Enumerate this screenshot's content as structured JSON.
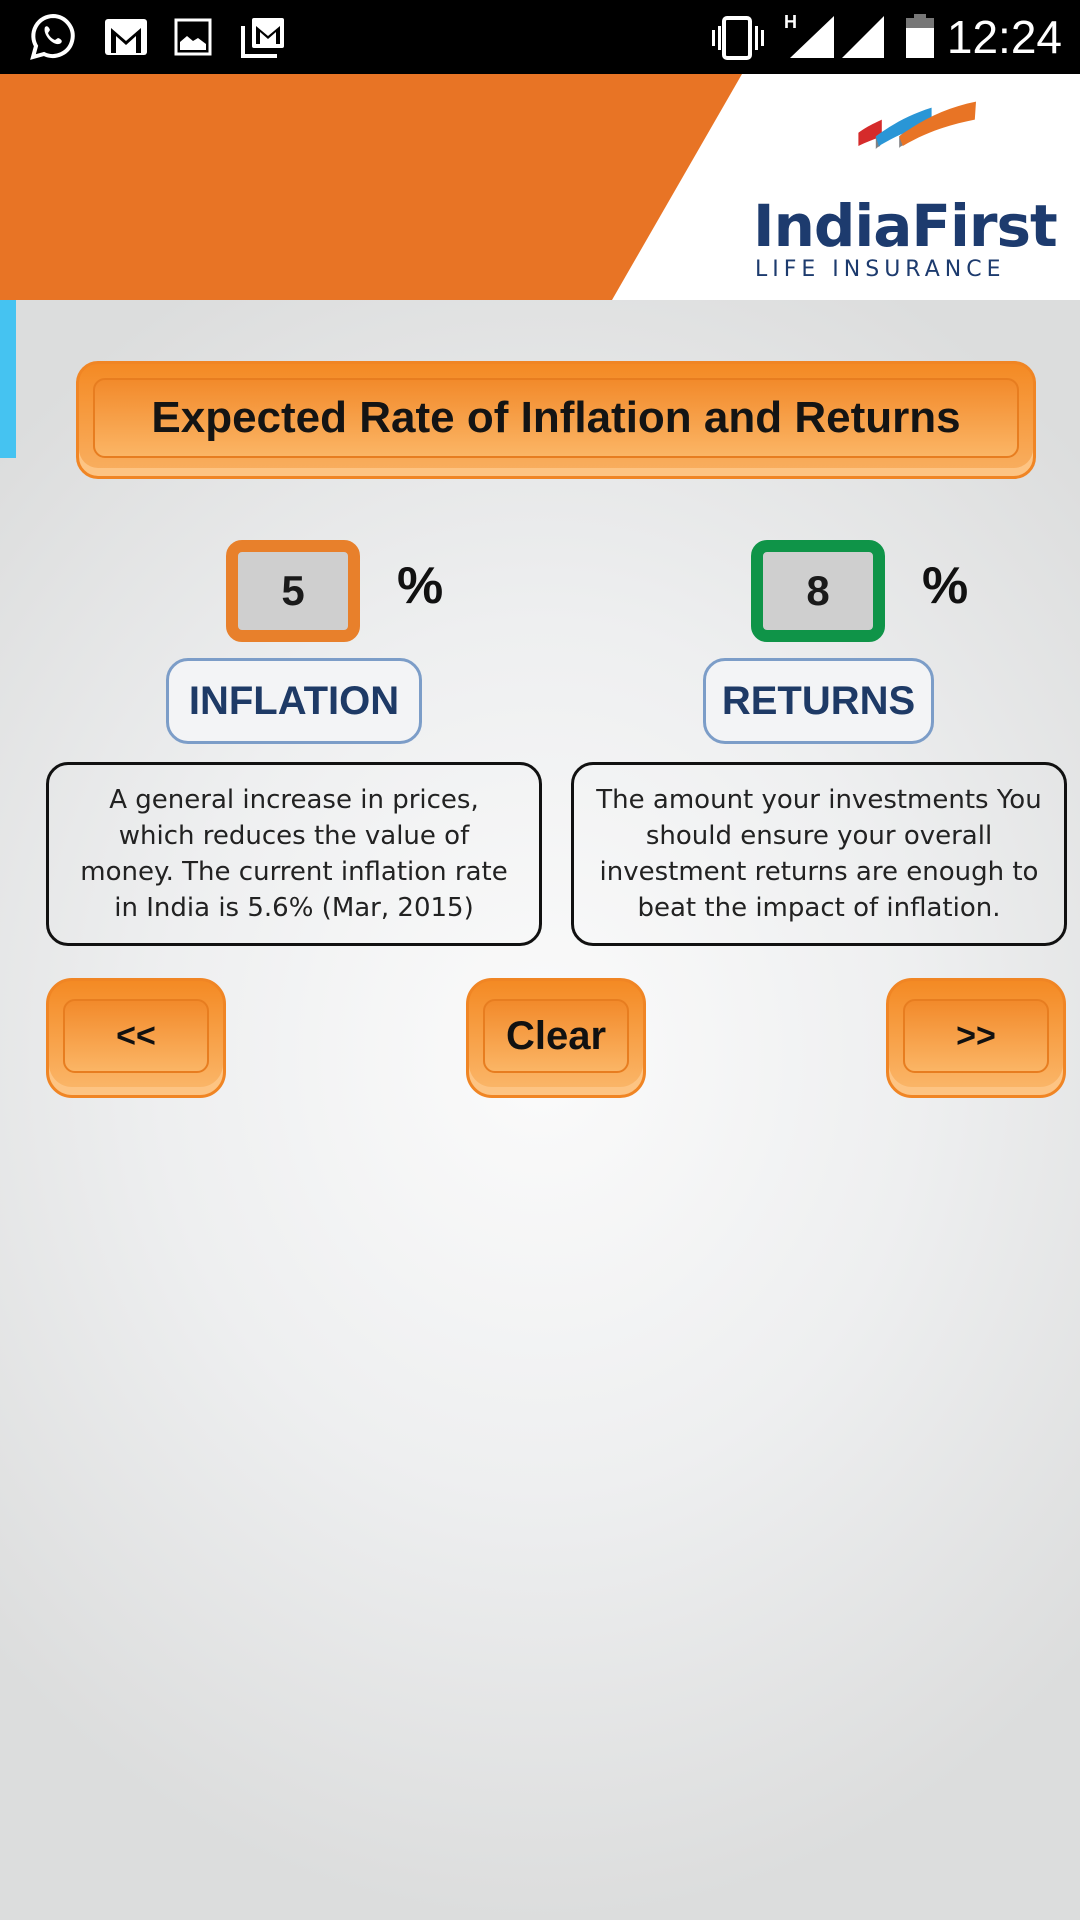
{
  "status_bar": {
    "notification_icons": [
      "whatsapp-icon",
      "gmail-icon",
      "gallery-icon",
      "gmail-stack-icon"
    ],
    "system_icons": [
      "vibrate-icon",
      "signal-h-icon",
      "signal-icon",
      "battery-icon"
    ],
    "network_type": "H",
    "time": "12:24"
  },
  "header": {
    "brand_name": "IndiaFirst",
    "brand_sub": "LIFE INSURANCE",
    "colors": {
      "orange": "#e87425",
      "navy": "#1d3b6e",
      "red": "#d52b2b",
      "blue": "#2a96d6",
      "gray": "#808083"
    }
  },
  "main": {
    "title": "Expected Rate of Inflation and Returns",
    "inflation": {
      "value": "5",
      "unit": "%",
      "label": "INFLATION",
      "border_color": "#e8802b",
      "description": "A general increase in prices, which reduces the value of money. The current inflation rate in India is 5.6% (Mar, 2015)"
    },
    "returns": {
      "value": "8",
      "unit": "%",
      "label": "RETURNS",
      "border_color": "#0f9448",
      "description": "The amount your investments You should ensure your overall investment returns are enough to beat the impact of inflation."
    },
    "buttons": {
      "prev": "<<",
      "clear": "Clear",
      "next": ">>"
    }
  }
}
